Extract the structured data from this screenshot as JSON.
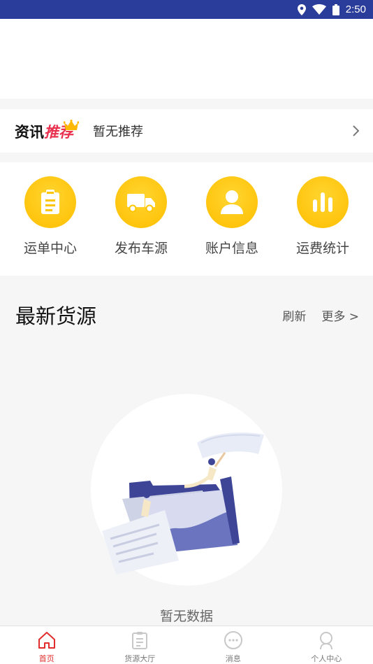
{
  "status_bar": {
    "time": "2:50"
  },
  "news": {
    "logo_part1": "资讯",
    "logo_part2": "推荐",
    "text": "暂无推荐"
  },
  "quick_actions": [
    {
      "label": "运单中心",
      "icon": "clipboard-icon"
    },
    {
      "label": "发布车源",
      "icon": "truck-icon"
    },
    {
      "label": "账户信息",
      "icon": "user-icon"
    },
    {
      "label": "运费统计",
      "icon": "bar-chart-icon"
    }
  ],
  "latest": {
    "title": "最新货源",
    "refresh": "刷新",
    "more": "更多 >"
  },
  "empty": {
    "text": "暂无数据"
  },
  "tabs": [
    {
      "label": "首页",
      "icon": "home-icon",
      "active": true
    },
    {
      "label": "货源大厅",
      "icon": "list-icon",
      "active": false
    },
    {
      "label": "消息",
      "icon": "chat-icon",
      "active": false
    },
    {
      "label": "个人中心",
      "icon": "person-icon",
      "active": false
    }
  ],
  "colors": {
    "status_bar": "#2b3d9a",
    "accent_yellow": "#ffc600",
    "active_red": "#e22d2d",
    "logo_red": "#e8304f"
  }
}
